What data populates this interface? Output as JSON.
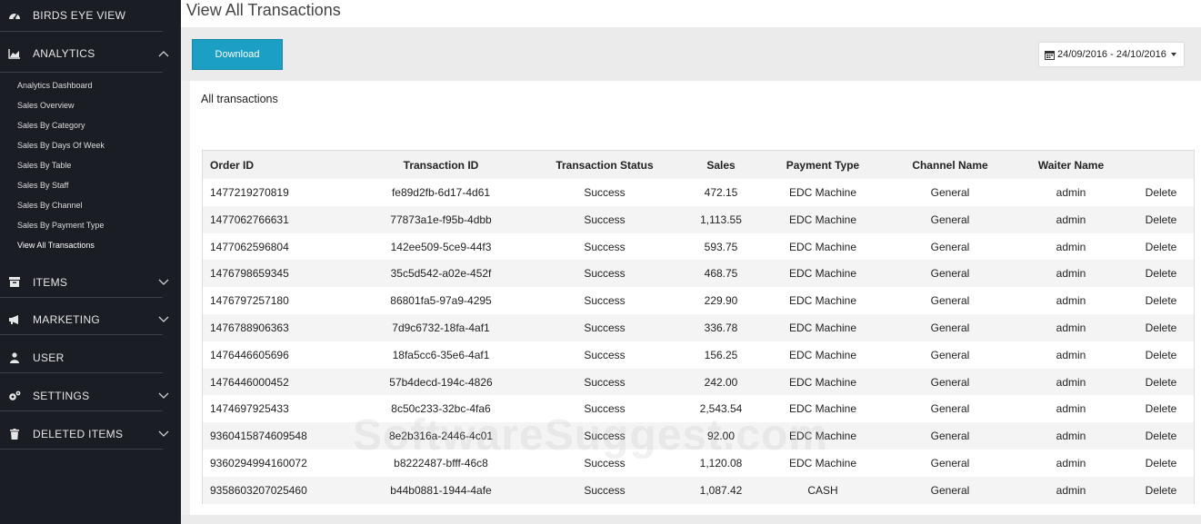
{
  "sidebar": {
    "items": [
      {
        "label": "BIRDS EYE VIEW",
        "icon": "dashboard-icon"
      },
      {
        "label": "ANALYTICS",
        "icon": "area-chart-icon",
        "expanded": true
      },
      {
        "label": "ITEMS",
        "icon": "inbox-icon"
      },
      {
        "label": "MARKETING",
        "icon": "bullhorn-icon"
      },
      {
        "label": "USER",
        "icon": "user-icon"
      },
      {
        "label": "SETTINGS",
        "icon": "cogs-icon"
      },
      {
        "label": "DELETED ITEMS",
        "icon": "trash-icon"
      }
    ],
    "analytics_sub": [
      "Analytics Dashboard",
      "Sales Overview",
      "Sales By Category",
      "Sales By Days Of Week",
      "Sales By Table",
      "Sales By Staff",
      "Sales By Channel",
      "Sales By Payment Type",
      "View All Transactions"
    ]
  },
  "page": {
    "title": "View All Transactions",
    "download_label": "Download",
    "date_range": "24/09/2016 - 24/10/2016",
    "panel_heading": "All transactions"
  },
  "table": {
    "columns": [
      "Order ID",
      "Transaction ID",
      "Transaction Status",
      "Sales",
      "Payment Type",
      "Channel Name",
      "Waiter Name"
    ],
    "action_label": "Delete",
    "rows": [
      [
        "1477219270819",
        "fe89d2fb-6d17-4d61",
        "Success",
        "472.15",
        "EDC Machine",
        "General",
        "admin"
      ],
      [
        "1477062766631",
        "77873a1e-f95b-4dbb",
        "Success",
        "1,113.55",
        "EDC Machine",
        "General",
        "admin"
      ],
      [
        "1477062596804",
        "142ee509-5ce9-44f3",
        "Success",
        "593.75",
        "EDC Machine",
        "General",
        "admin"
      ],
      [
        "1476798659345",
        "35c5d542-a02e-452f",
        "Success",
        "468.75",
        "EDC Machine",
        "General",
        "admin"
      ],
      [
        "1476797257180",
        "86801fa5-97a9-4295",
        "Success",
        "229.90",
        "EDC Machine",
        "General",
        "admin"
      ],
      [
        "1476788906363",
        "7d9c6732-18fa-4af1",
        "Success",
        "336.78",
        "EDC Machine",
        "General",
        "admin"
      ],
      [
        "1476446605696",
        "18fa5cc6-35e6-4af1",
        "Success",
        "156.25",
        "EDC Machine",
        "General",
        "admin"
      ],
      [
        "1476446000452",
        "57b4decd-194c-4826",
        "Success",
        "242.00",
        "EDC Machine",
        "General",
        "admin"
      ],
      [
        "1474697925433",
        "8c50c233-32bc-4fa6",
        "Success",
        "2,543.54",
        "EDC Machine",
        "General",
        "admin"
      ],
      [
        "9360415874609548",
        "8e2b316a-2446-4c01",
        "Success",
        "92.00",
        "EDC Machine",
        "General",
        "admin"
      ],
      [
        "9360294994160072",
        "b8222487-bfff-46c8",
        "Success",
        "1,120.08",
        "EDC Machine",
        "General",
        "admin"
      ],
      [
        "9358603207025460",
        "b44b0881-1944-4afe",
        "Success",
        "1,087.42",
        "CASH",
        "General",
        "admin"
      ]
    ]
  },
  "watermark": "SoftwareSuggest.com",
  "colors": {
    "sidebar_bg": "#1a1d24",
    "accent": "#1b9fc4"
  }
}
